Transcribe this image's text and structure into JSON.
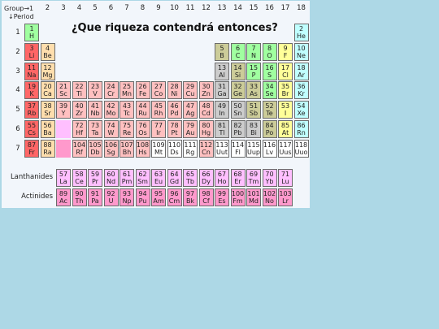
{
  "corner": {
    "group": "Group→1",
    "period": "↓Period"
  },
  "title": "¿Que riqueza contendrá entonces?",
  "group_numbers": [
    "2",
    "3",
    "4",
    "5",
    "6",
    "7",
    "8",
    "9",
    "10",
    "11",
    "12",
    "13",
    "14",
    "15",
    "16",
    "17",
    "18"
  ],
  "periods": [
    "1",
    "2",
    "3",
    "4",
    "5",
    "6",
    "7"
  ],
  "series_labels": {
    "lanthanides": "Lanthanides",
    "actinides": "Actinides"
  },
  "colors": {
    "alkali": "#ff6666",
    "alkaline": "#ffdead",
    "transition": "#ffc0c0",
    "post_transition": "#cccccc",
    "metalloid": "#cccc99",
    "nonmetal": "#a0ffa0",
    "halogen": "#ffff99",
    "noble": "#c0ffff",
    "lanthanide": "#ffbfff",
    "actinide": "#ff99cc",
    "placeholder": "#ffbfff",
    "placeholder_ac": "#ff99cc",
    "background": "#add8e6"
  },
  "elements": [
    {
      "z": "1",
      "s": "H",
      "cat": "nonmetal",
      "period": 1,
      "group": 1
    },
    {
      "z": "2",
      "s": "He",
      "cat": "noble",
      "period": 1,
      "group": 18
    },
    {
      "z": "3",
      "s": "Li",
      "cat": "alkali",
      "period": 2,
      "group": 1
    },
    {
      "z": "4",
      "s": "Be",
      "cat": "alkaline",
      "period": 2,
      "group": 2
    },
    {
      "z": "5",
      "s": "B",
      "cat": "metalloid",
      "period": 2,
      "group": 13
    },
    {
      "z": "6",
      "s": "C",
      "cat": "nonmetal",
      "period": 2,
      "group": 14
    },
    {
      "z": "7",
      "s": "N",
      "cat": "nonmetal",
      "period": 2,
      "group": 15
    },
    {
      "z": "8",
      "s": "O",
      "cat": "nonmetal",
      "period": 2,
      "group": 16
    },
    {
      "z": "9",
      "s": "F",
      "cat": "halogen",
      "period": 2,
      "group": 17
    },
    {
      "z": "10",
      "s": "Ne",
      "cat": "noble",
      "period": 2,
      "group": 18
    },
    {
      "z": "11",
      "s": "Na",
      "cat": "alkali",
      "period": 3,
      "group": 1
    },
    {
      "z": "12",
      "s": "Mg",
      "cat": "alkaline",
      "period": 3,
      "group": 2
    },
    {
      "z": "13",
      "s": "Al",
      "cat": "post_transition",
      "period": 3,
      "group": 13
    },
    {
      "z": "14",
      "s": "Si",
      "cat": "metalloid",
      "period": 3,
      "group": 14
    },
    {
      "z": "15",
      "s": "P",
      "cat": "nonmetal",
      "period": 3,
      "group": 15
    },
    {
      "z": "16",
      "s": "S",
      "cat": "nonmetal",
      "period": 3,
      "group": 16
    },
    {
      "z": "17",
      "s": "Cl",
      "cat": "halogen",
      "period": 3,
      "group": 17
    },
    {
      "z": "18",
      "s": "Ar",
      "cat": "noble",
      "period": 3,
      "group": 18
    },
    {
      "z": "19",
      "s": "K",
      "cat": "alkali",
      "period": 4,
      "group": 1
    },
    {
      "z": "20",
      "s": "Ca",
      "cat": "alkaline",
      "period": 4,
      "group": 2
    },
    {
      "z": "21",
      "s": "Sc",
      "cat": "transition",
      "period": 4,
      "group": 3
    },
    {
      "z": "22",
      "s": "Ti",
      "cat": "transition",
      "period": 4,
      "group": 4
    },
    {
      "z": "23",
      "s": "V",
      "cat": "transition",
      "period": 4,
      "group": 5
    },
    {
      "z": "24",
      "s": "Cr",
      "cat": "transition",
      "period": 4,
      "group": 6
    },
    {
      "z": "25",
      "s": "Mn",
      "cat": "transition",
      "period": 4,
      "group": 7
    },
    {
      "z": "26",
      "s": "Fe",
      "cat": "transition",
      "period": 4,
      "group": 8
    },
    {
      "z": "27",
      "s": "Co",
      "cat": "transition",
      "period": 4,
      "group": 9
    },
    {
      "z": "28",
      "s": "Ni",
      "cat": "transition",
      "period": 4,
      "group": 10
    },
    {
      "z": "29",
      "s": "Cu",
      "cat": "transition",
      "period": 4,
      "group": 11
    },
    {
      "z": "30",
      "s": "Zn",
      "cat": "transition",
      "period": 4,
      "group": 12
    },
    {
      "z": "31",
      "s": "Ga",
      "cat": "post_transition",
      "period": 4,
      "group": 13
    },
    {
      "z": "32",
      "s": "Ge",
      "cat": "metalloid",
      "period": 4,
      "group": 14
    },
    {
      "z": "33",
      "s": "As",
      "cat": "metalloid",
      "period": 4,
      "group": 15
    },
    {
      "z": "34",
      "s": "Se",
      "cat": "nonmetal",
      "period": 4,
      "group": 16
    },
    {
      "z": "35",
      "s": "Br",
      "cat": "halogen",
      "period": 4,
      "group": 17
    },
    {
      "z": "36",
      "s": "Kr",
      "cat": "noble",
      "period": 4,
      "group": 18
    },
    {
      "z": "37",
      "s": "Rb",
      "cat": "alkali",
      "period": 5,
      "group": 1
    },
    {
      "z": "38",
      "s": "Sr",
      "cat": "alkaline",
      "period": 5,
      "group": 2
    },
    {
      "z": "39",
      "s": "Y",
      "cat": "transition",
      "period": 5,
      "group": 3
    },
    {
      "z": "40",
      "s": "Zr",
      "cat": "transition",
      "period": 5,
      "group": 4
    },
    {
      "z": "41",
      "s": "Nb",
      "cat": "transition",
      "period": 5,
      "group": 5
    },
    {
      "z": "42",
      "s": "Mo",
      "cat": "transition",
      "period": 5,
      "group": 6
    },
    {
      "z": "43",
      "s": "Tc",
      "cat": "transition",
      "period": 5,
      "group": 7
    },
    {
      "z": "44",
      "s": "Ru",
      "cat": "transition",
      "period": 5,
      "group": 8
    },
    {
      "z": "45",
      "s": "Rh",
      "cat": "transition",
      "period": 5,
      "group": 9
    },
    {
      "z": "46",
      "s": "Pd",
      "cat": "transition",
      "period": 5,
      "group": 10
    },
    {
      "z": "47",
      "s": "Ag",
      "cat": "transition",
      "period": 5,
      "group": 11
    },
    {
      "z": "48",
      "s": "Cd",
      "cat": "transition",
      "period": 5,
      "group": 12
    },
    {
      "z": "49",
      "s": "In",
      "cat": "post_transition",
      "period": 5,
      "group": 13
    },
    {
      "z": "50",
      "s": "Sn",
      "cat": "post_transition",
      "period": 5,
      "group": 14
    },
    {
      "z": "51",
      "s": "Sb",
      "cat": "metalloid",
      "period": 5,
      "group": 15
    },
    {
      "z": "52",
      "s": "Te",
      "cat": "metalloid",
      "period": 5,
      "group": 16
    },
    {
      "z": "53",
      "s": "I",
      "cat": "halogen",
      "period": 5,
      "group": 17
    },
    {
      "z": "54",
      "s": "Xe",
      "cat": "noble",
      "period": 5,
      "group": 18
    },
    {
      "z": "55",
      "s": "Cs",
      "cat": "alkali",
      "period": 6,
      "group": 1
    },
    {
      "z": "56",
      "s": "Ba",
      "cat": "alkaline",
      "period": 6,
      "group": 2
    },
    {
      "z": "72",
      "s": "Hf",
      "cat": "transition",
      "period": 6,
      "group": 4
    },
    {
      "z": "73",
      "s": "Ta",
      "cat": "transition",
      "period": 6,
      "group": 5
    },
    {
      "z": "74",
      "s": "W",
      "cat": "transition",
      "period": 6,
      "group": 6
    },
    {
      "z": "75",
      "s": "Re",
      "cat": "transition",
      "period": 6,
      "group": 7
    },
    {
      "z": "76",
      "s": "Os",
      "cat": "transition",
      "period": 6,
      "group": 8
    },
    {
      "z": "77",
      "s": "Ir",
      "cat": "transition",
      "period": 6,
      "group": 9
    },
    {
      "z": "78",
      "s": "Pt",
      "cat": "transition",
      "period": 6,
      "group": 10
    },
    {
      "z": "79",
      "s": "Au",
      "cat": "transition",
      "period": 6,
      "group": 11
    },
    {
      "z": "80",
      "s": "Hg",
      "cat": "transition",
      "period": 6,
      "group": 12
    },
    {
      "z": "81",
      "s": "Tl",
      "cat": "post_transition",
      "period": 6,
      "group": 13
    },
    {
      "z": "82",
      "s": "Pb",
      "cat": "post_transition",
      "period": 6,
      "group": 14
    },
    {
      "z": "83",
      "s": "Bi",
      "cat": "post_transition",
      "period": 6,
      "group": 15
    },
    {
      "z": "84",
      "s": "Po",
      "cat": "metalloid",
      "period": 6,
      "group": 16
    },
    {
      "z": "85",
      "s": "At",
      "cat": "halogen",
      "period": 6,
      "group": 17
    },
    {
      "z": "86",
      "s": "Rn",
      "cat": "noble",
      "period": 6,
      "group": 18
    },
    {
      "z": "87",
      "s": "Fr",
      "cat": "alkali",
      "period": 7,
      "group": 1
    },
    {
      "z": "88",
      "s": "Ra",
      "cat": "alkaline",
      "period": 7,
      "group": 2
    },
    {
      "z": "104",
      "s": "Rf",
      "cat": "transition",
      "period": 7,
      "group": 4
    },
    {
      "z": "105",
      "s": "Db",
      "cat": "transition",
      "period": 7,
      "group": 5
    },
    {
      "z": "106",
      "s": "Sg",
      "cat": "transition",
      "period": 7,
      "group": 6
    },
    {
      "z": "107",
      "s": "Bh",
      "cat": "transition",
      "period": 7,
      "group": 7
    },
    {
      "z": "108",
      "s": "Hs",
      "cat": "transition",
      "period": 7,
      "group": 8
    },
    {
      "z": "109",
      "s": "Mt",
      "cat": "unknown",
      "period": 7,
      "group": 9
    },
    {
      "z": "110",
      "s": "Ds",
      "cat": "unknown",
      "period": 7,
      "group": 10
    },
    {
      "z": "111",
      "s": "Rg",
      "cat": "unknown",
      "period": 7,
      "group": 11
    },
    {
      "z": "112",
      "s": "Cn",
      "cat": "transition",
      "period": 7,
      "group": 12
    },
    {
      "z": "113",
      "s": "Uut",
      "cat": "unknown",
      "period": 7,
      "group": 13
    },
    {
      "z": "114",
      "s": "Fl",
      "cat": "unknown",
      "period": 7,
      "group": 14
    },
    {
      "z": "115",
      "s": "Uup",
      "cat": "unknown",
      "period": 7,
      "group": 15
    },
    {
      "z": "116",
      "s": "Lv",
      "cat": "unknown",
      "period": 7,
      "group": 16
    },
    {
      "z": "117",
      "s": "Uus",
      "cat": "unknown",
      "period": 7,
      "group": 17
    },
    {
      "z": "118",
      "s": "Uuo",
      "cat": "unknown",
      "period": 7,
      "group": 18
    }
  ],
  "lanthanides": [
    {
      "z": "57",
      "s": "La"
    },
    {
      "z": "58",
      "s": "Ce"
    },
    {
      "z": "59",
      "s": "Pr"
    },
    {
      "z": "60",
      "s": "Nd"
    },
    {
      "z": "61",
      "s": "Pm"
    },
    {
      "z": "62",
      "s": "Sm"
    },
    {
      "z": "63",
      "s": "Eu"
    },
    {
      "z": "64",
      "s": "Gd"
    },
    {
      "z": "65",
      "s": "Tb"
    },
    {
      "z": "66",
      "s": "Dy"
    },
    {
      "z": "67",
      "s": "Ho"
    },
    {
      "z": "68",
      "s": "Er"
    },
    {
      "z": "69",
      "s": "Tm"
    },
    {
      "z": "70",
      "s": "Yb"
    },
    {
      "z": "71",
      "s": "Lu"
    }
  ],
  "actinides": [
    {
      "z": "89",
      "s": "Ac"
    },
    {
      "z": "90",
      "s": "Th"
    },
    {
      "z": "91",
      "s": "Pa"
    },
    {
      "z": "92",
      "s": "U"
    },
    {
      "z": "93",
      "s": "Np"
    },
    {
      "z": "94",
      "s": "Pu"
    },
    {
      "z": "95",
      "s": "Am"
    },
    {
      "z": "96",
      "s": "Cm"
    },
    {
      "z": "97",
      "s": "Bk"
    },
    {
      "z": "98",
      "s": "Cf"
    },
    {
      "z": "99",
      "s": "Es"
    },
    {
      "z": "100",
      "s": "Fm"
    },
    {
      "z": "101",
      "s": "Md"
    },
    {
      "z": "102",
      "s": "No"
    },
    {
      "z": "103",
      "s": "Lr"
    }
  ]
}
